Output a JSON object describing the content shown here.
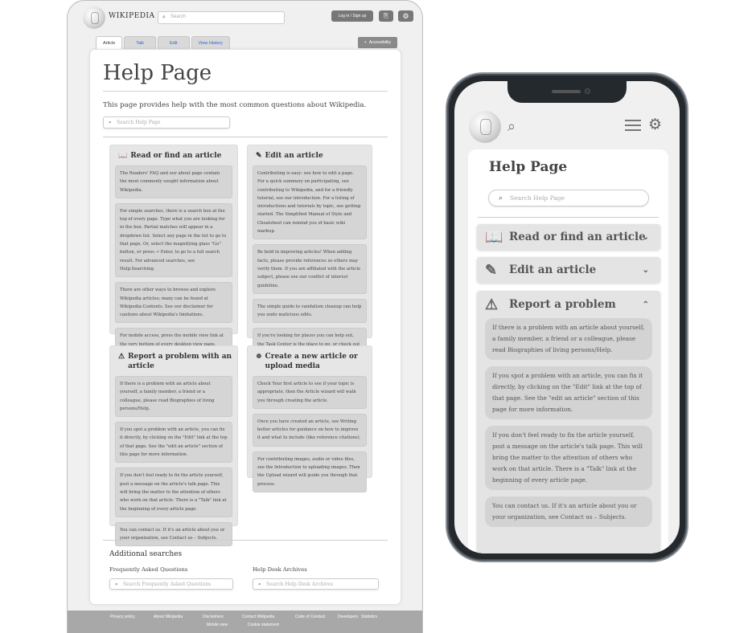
{
  "desktop": {
    "header": {
      "wordmark": "WIKIPEDIA",
      "search_placeholder": "Search",
      "login_label": "Log in / Sign up",
      "translate_icon": "translate-icon",
      "settings_icon": "gear-icon"
    },
    "tabs": [
      "Article",
      "Talk",
      "Edit",
      "View History"
    ],
    "accessibility_label": "Accessibility",
    "title": "Help Page",
    "intro": "This page provides help with the most common questions about Wikipedia.",
    "help_search_placeholder": "Search Help Page",
    "sections": {
      "read": {
        "heading": "Read or find an article",
        "icon": "book-icon",
        "blocks": [
          "The Readers' FAQ and our about page contain the most commonly sought information about Wikipedia.",
          "For simple searches, there is a search box at the top of every page. Type what you are looking for in the box. Partial matches will appear in a dropdown list. Select any page in the list to go to that page. Or, select the magnifying glass \"Go\" button, or press ↵ Enter, to go to a full search result. For advanced searches, see Help:Searching.",
          "There are other ways to browse and explore Wikipedia articles; many can be found at Wikipedia:Contents. See our disclaimer for cautions about Wikipedia's limitations.",
          "For mobile access, press the mobile view link at the very bottom of every desktop view page."
        ]
      },
      "edit": {
        "heading": "Edit an article",
        "icon": "edit-icon",
        "blocks": [
          "Contributing is easy: see how to edit a page. For a quick summary on participating, see contributing to Wikipedia, and for a friendly tutorial, see our introduction. For a listing of introductions and tutorials by topic, see getting started. The Simplified Manual of Style and Cheatsheet can remind you of basic wiki markup.",
          "Be bold in improving articles! When adding facts, please provide references so others may verify them. If you are affiliated with the article subject, please see our conflict of interest guideline.",
          "The simple guide to vandalism cleanup can help you undo malicious edits.",
          "If you're looking for places you can help out, the Task Center is the place to go, or check out what else is happening at the community portal. You can practice editing and experiment in a sandbox."
        ]
      },
      "report": {
        "heading": "Report a problem with an article",
        "icon": "warning-icon",
        "blocks": [
          "If there is a problem with an article about yourself, a family member, a friend or a colleague, please read Biographies of living persons/Help.",
          "If you spot a problem with an article, you can fix it directly, by clicking on the \"Edit\" link at the top of that page. See the \"edit an article\" section of this page for more information.",
          "If you don't feel ready to fix the article yourself, post a message on the article's talk page. This will bring the matter to the attention of others who work on that article. There is a \"Talk\" link at the beginning of every article page.",
          "You can contact us. If it's an article about you or your organization, see Contact us – Subjects."
        ]
      },
      "create": {
        "heading": "Create a new article or upload media",
        "icon": "plus-circle-icon",
        "blocks": [
          "Check Your first article to see if your topic is appropriate, then the Article wizard will walk you through creating the article.",
          "Once you have created an article, see Writing better articles for guidance on how to improve it and what to include (like reference citations).",
          "For contributing images, audio or video files, see the Introduction to uploading images. Then the Upload wizard will guide you through that process."
        ]
      }
    },
    "additional": {
      "heading": "Additional searches",
      "faq_label": "Frequently Asked Questions",
      "faq_placeholder": "Search Frequently Asked Questions",
      "archives_label": "Help Desk Archives",
      "archives_placeholder": "Search Help Desk Archives"
    },
    "footer": [
      "Privacy policy",
      "About Wikipedia",
      "Disclaimers",
      "Contact Wikipedia",
      "Code of Conduct",
      "Developers",
      "Statistics",
      "Mobile view",
      "Cookie statement"
    ]
  },
  "mobile": {
    "title": "Help Page",
    "search_placeholder": "Search Help Page",
    "sections": [
      {
        "label": "Read or find an article",
        "icon": "book-icon",
        "chevron": "⌄"
      },
      {
        "label": "Edit an article",
        "icon": "edit-icon",
        "chevron": "⌄"
      },
      {
        "label": "Report a problem",
        "icon": "warning-icon",
        "chevron": "⌃"
      }
    ],
    "report_blocks": [
      "If there is a problem with an article about yourself, a family member, a friend or a colleague, please read Biographies of living persons/Help.",
      "If you spot a problem with an article, you can fix it directly, by clicking on the \"Edit\" link at the top of that page. See the \"edit an article\" section of this page for more information.",
      "If you don't feel ready to fix the article yourself, post a message on the article's talk page. This will bring the matter to the attention of others who work on that article. There is a \"Talk\" link at the beginning of every article page.",
      "You can contact us. If it's an article about you or your organization, see Contact us – Subjects."
    ]
  }
}
